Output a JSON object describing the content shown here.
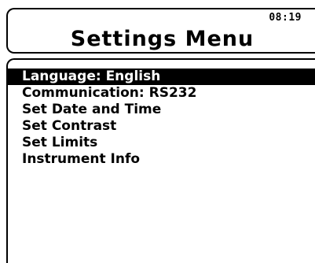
{
  "header": {
    "time": "08:19",
    "battery_icon": "battery-icon",
    "title": "Settings Menu"
  },
  "menu": {
    "selected_index": 0,
    "items": [
      {
        "label": "Language: English"
      },
      {
        "label": "Communication: RS232"
      },
      {
        "label": "Set Date and Time"
      },
      {
        "label": "Set Contrast"
      },
      {
        "label": "Set Limits"
      },
      {
        "label": "Instrument Info"
      }
    ]
  },
  "colors": {
    "background": "#ffffff",
    "foreground": "#000000",
    "highlight": "#000000",
    "highlight_text": "#ffffff"
  }
}
